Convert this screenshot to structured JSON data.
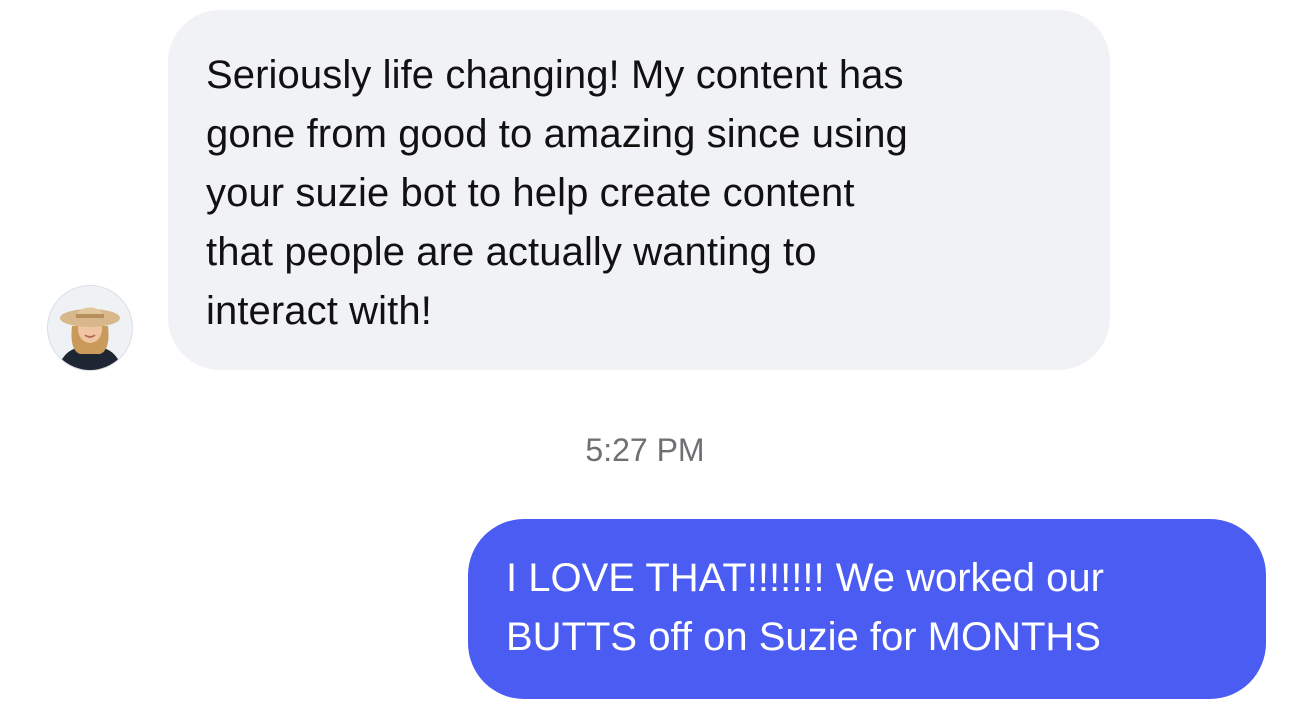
{
  "conversation": {
    "incoming": {
      "text": "Seriously life changing! My content has\ngone from good to amazing since using\nyour suzie bot to help create content\nthat people are actually wanting to\ninteract with!",
      "avatar_icon": "contact-avatar-photo",
      "bubble_color": "#f1f2f5"
    },
    "timestamp": "5:27 PM",
    "outgoing": {
      "text": "I LOVE THAT!!!!!!! We worked our\nBUTTS off on Suzie for MONTHS",
      "bubble_color": "#4b5cf2"
    }
  }
}
